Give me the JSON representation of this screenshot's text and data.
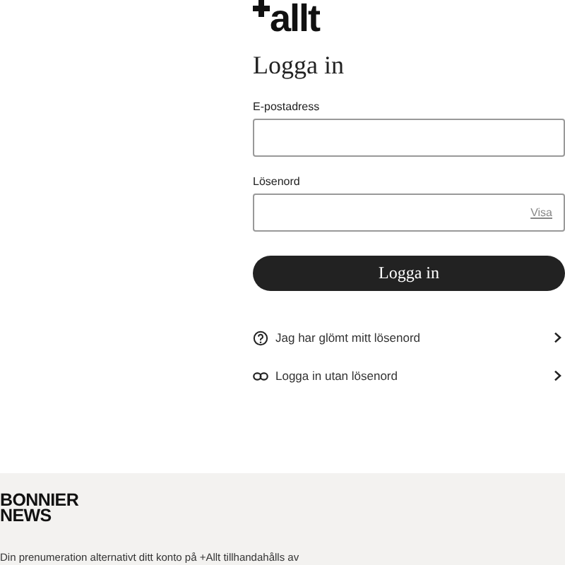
{
  "logo": {
    "text": "allt"
  },
  "heading": "Logga in",
  "fields": [
    {
      "label": "E-postadress",
      "kind": "text"
    },
    {
      "label": "Lösenord",
      "kind": "password",
      "toggle": "Visa"
    }
  ],
  "submit": "Logga in",
  "links": [
    {
      "kind": "question",
      "label": "Jag har glömt mitt lösenord"
    },
    {
      "kind": "link",
      "label": "Logga in utan lösenord"
    }
  ],
  "footer": {
    "brand": [
      "BONNIER",
      "NEWS"
    ],
    "text": "Din prenumeration alternativt ditt konto på +Allt tillhandahålls av"
  }
}
